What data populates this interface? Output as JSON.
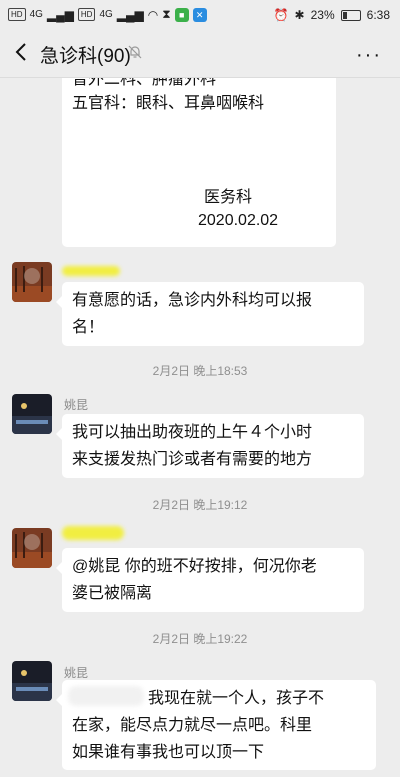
{
  "status_bar": {
    "left_badges": [
      "HD",
      "HD"
    ],
    "signal1": "4G",
    "signal2": "4G",
    "battery": "23%",
    "time": "6:38"
  },
  "header": {
    "title": "急诊科(90)",
    "more": "···"
  },
  "notice": {
    "line1": "普外二科、肿瘤外科",
    "line2": "五官科：眼科、耳鼻咽喉科",
    "signer": "医务科",
    "date": "2020.02.02"
  },
  "messages": [
    {
      "sender": "",
      "text_lines": [
        "有意愿的话，急诊内外科均可以报",
        "名！"
      ]
    },
    {
      "time": "2月2日 晚上18:53"
    },
    {
      "sender": "姚昆",
      "text_lines": [
        "我可以抽出助夜班的上午４个小时",
        "来支援发热门诊或者有需要的地方"
      ]
    },
    {
      "time": "2月2日 晚上19:12"
    },
    {
      "sender": "",
      "text_lines": [
        "@姚昆  你的班不好按排，何况你老",
        "婆已被隔离"
      ]
    },
    {
      "time": "2月2日 晚上19:22"
    },
    {
      "sender": "姚昆",
      "text_lines": [
        "我现在就一个人，孩子不",
        "在家，能尽点力就尽一点吧。科里",
        "如果谁有事我也可以顶一下"
      ]
    }
  ]
}
